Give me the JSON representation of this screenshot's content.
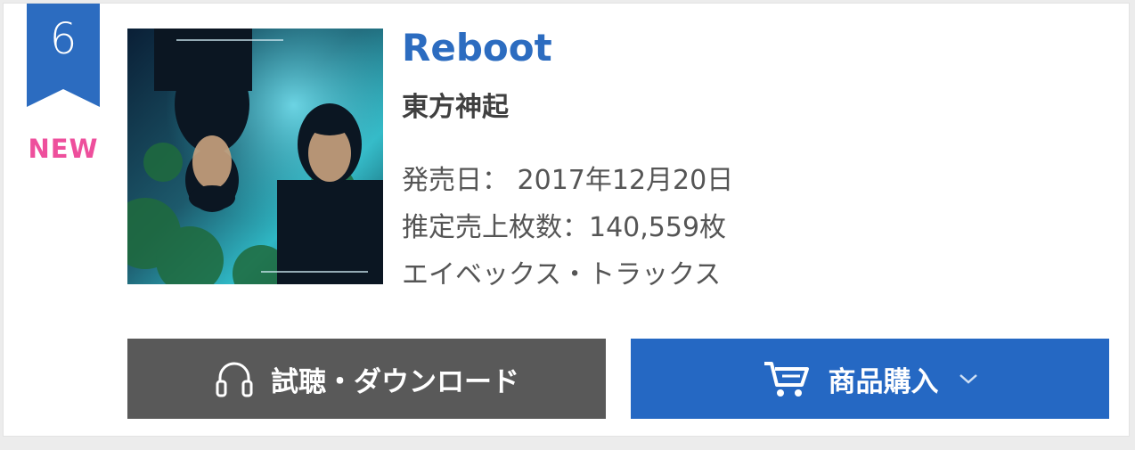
{
  "rank": {
    "number": "6",
    "ribbon_color": "#2c6cc0",
    "new_label": "NEW",
    "new_color": "#ee4f9c"
  },
  "item": {
    "jacket_alt": "Reboot jacket image",
    "title": "Reboot",
    "artist": "東方神起",
    "release_date": "発売日： 2017年12月20日",
    "estimated_sales": "推定売上枚数：140,559枚",
    "label": "エイベックス・トラックス"
  },
  "actions": {
    "listen_label": "試聴・ダウンロード",
    "listen_icon": "headphones-icon",
    "buy_label": "商品購入",
    "buy_icon": "shopping-cart-icon",
    "buy_caret_icon": "chevron-down-icon",
    "listen_color": "#595959",
    "buy_color": "#2568c3"
  }
}
